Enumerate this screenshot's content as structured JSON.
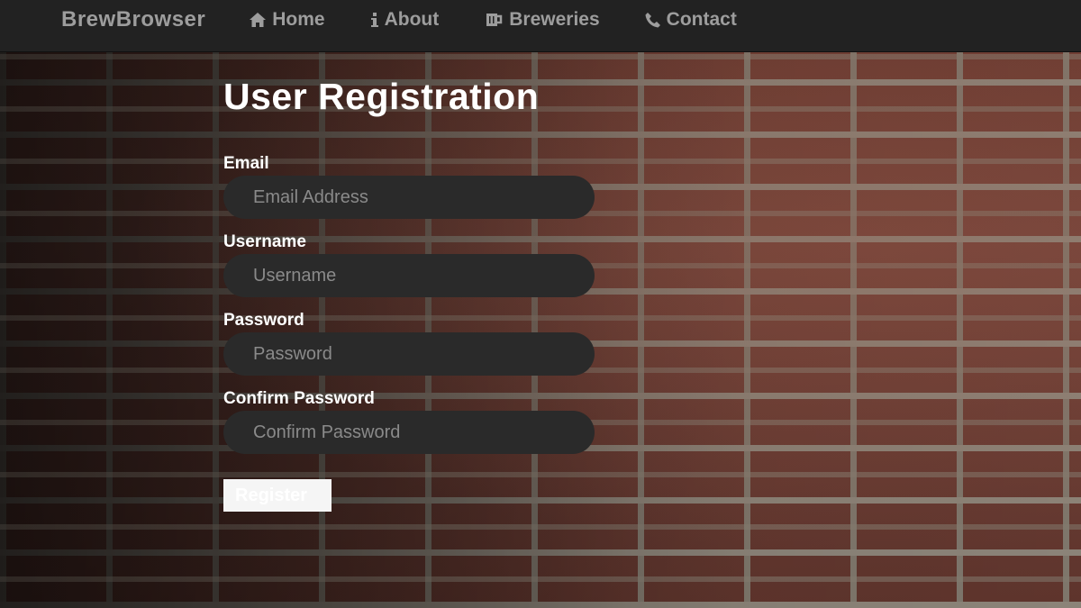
{
  "nav": {
    "brand": "BrewBrowser",
    "links": [
      {
        "label": "Home",
        "icon": "home-icon"
      },
      {
        "label": "About",
        "icon": "info-icon"
      },
      {
        "label": "Breweries",
        "icon": "beer-icon"
      },
      {
        "label": "Contact",
        "icon": "phone-icon"
      }
    ]
  },
  "form": {
    "title": "User Registration",
    "email_label": "Email",
    "email_placeholder": "Email Address",
    "username_label": "Username",
    "username_placeholder": "Username",
    "password_label": "Password",
    "password_placeholder": "Password",
    "confirm_label": "Confirm Password",
    "confirm_placeholder": "Confirm Password",
    "submit_label": "Register"
  },
  "colors": {
    "navbar_bg": "#222222",
    "nav_text": "#9d9d9d",
    "input_bg": "#2a2a2a",
    "button_bg": "#f5f5f5"
  }
}
